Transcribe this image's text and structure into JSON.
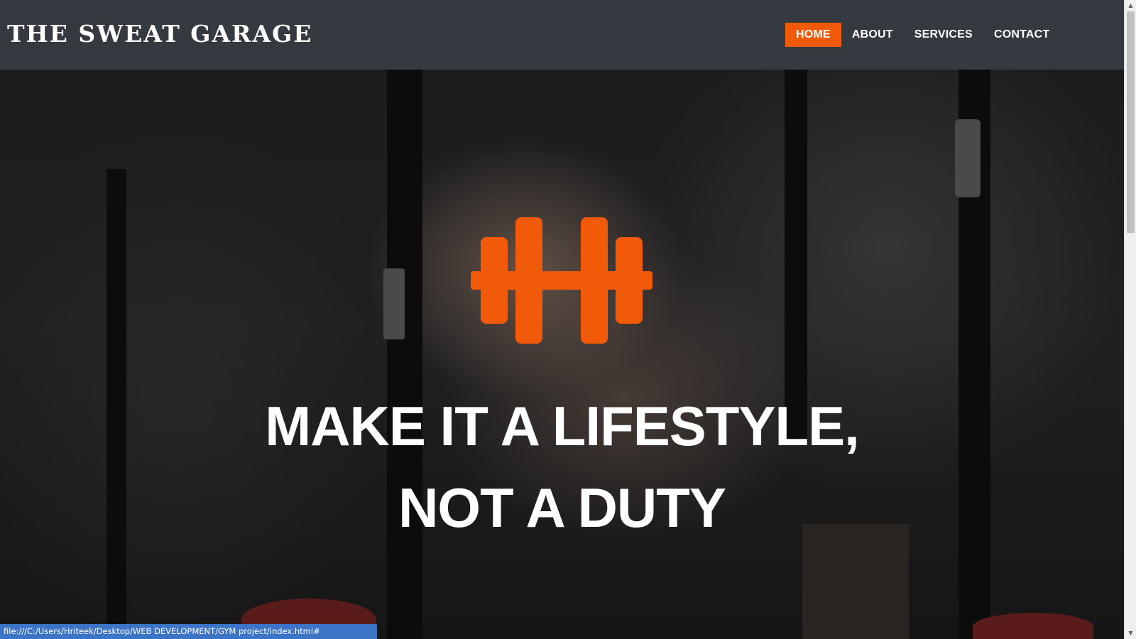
{
  "navbar": {
    "brand": "THE SWEAT GARAGE",
    "links": [
      {
        "label": "HOME",
        "active": true
      },
      {
        "label": "ABOUT",
        "active": false
      },
      {
        "label": "SERVICES",
        "active": false
      },
      {
        "label": "CONTACT",
        "active": false
      }
    ]
  },
  "hero": {
    "icon": "dumbbell-icon",
    "headline_line1": "MAKE IT A LIFESTYLE,",
    "headline_line2": "NOT A DUTY"
  },
  "status_bar": {
    "url": "file:///C:/Users/Hriteek/Desktop/WEB DEVELOPMENT/GYM project/index.html#"
  },
  "colors": {
    "accent": "#f15a09",
    "navbar_bg": "#343a40",
    "status_bg": "#3c74c7"
  }
}
